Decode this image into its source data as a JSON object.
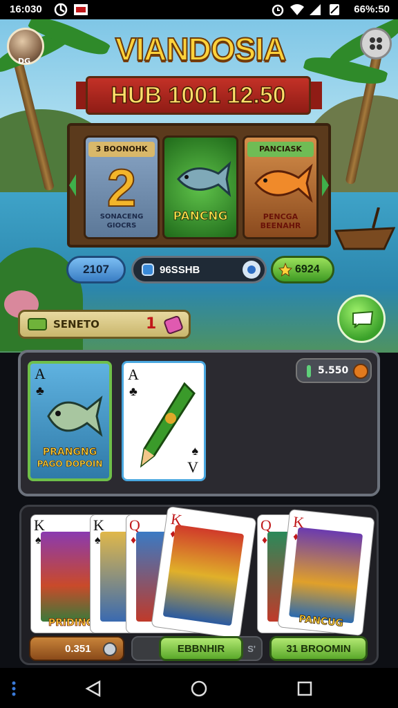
{
  "status_bar": {
    "time": "16:030",
    "battery_text": "66%:50"
  },
  "header": {
    "title": "VIANDOSIA",
    "banner": "HUB 1001 12.50",
    "avatar_label": "DG"
  },
  "panels": [
    {
      "title": "3 BOONOHK",
      "caption": "SONACENG GIOCRS"
    },
    {
      "title": "",
      "caption": "PANCNG"
    },
    {
      "title": "PANCIASK",
      "caption": "PENCGA BEENAHR"
    }
  ],
  "stats": {
    "left": "2107",
    "middle": "96SSHB",
    "right": "6924"
  },
  "bonus": {
    "label": "SENETO",
    "count": "1"
  },
  "table": {
    "coins": "5.550",
    "card1": {
      "rank": "A",
      "suit": "♣",
      "caption_line1": "PRANGNG",
      "caption_line2": "PAGO DOPOIN"
    },
    "card2": {
      "rank": "A",
      "suit": "♣",
      "bottom_rank": "V",
      "bottom_suit": "♠"
    }
  },
  "hand": {
    "cards": [
      {
        "rank": "K",
        "suit": "♠",
        "caption": "PRIDING",
        "color": "#111"
      },
      {
        "rank": "K",
        "suit": "♠",
        "caption": "",
        "color": "#111"
      },
      {
        "rank": "Q",
        "suit": "♦",
        "caption": "",
        "color": "#c0181a"
      },
      {
        "rank": "K",
        "suit": "♦",
        "caption": "",
        "color": "#c0181a"
      },
      {
        "rank": "Q",
        "suit": "♦",
        "caption": "",
        "color": "#c0181a"
      },
      {
        "rank": "K",
        "suit": "♦",
        "caption": "PANCUG",
        "color": "#c0181a"
      }
    ],
    "left_value": "0.351",
    "center_label": "EBBNHIR",
    "center_right": "S'",
    "right_label": "31 BROOMIN"
  },
  "colors": {
    "gold": "#ffd23a",
    "banner_red": "#c33127",
    "green": "#3aa12a"
  }
}
